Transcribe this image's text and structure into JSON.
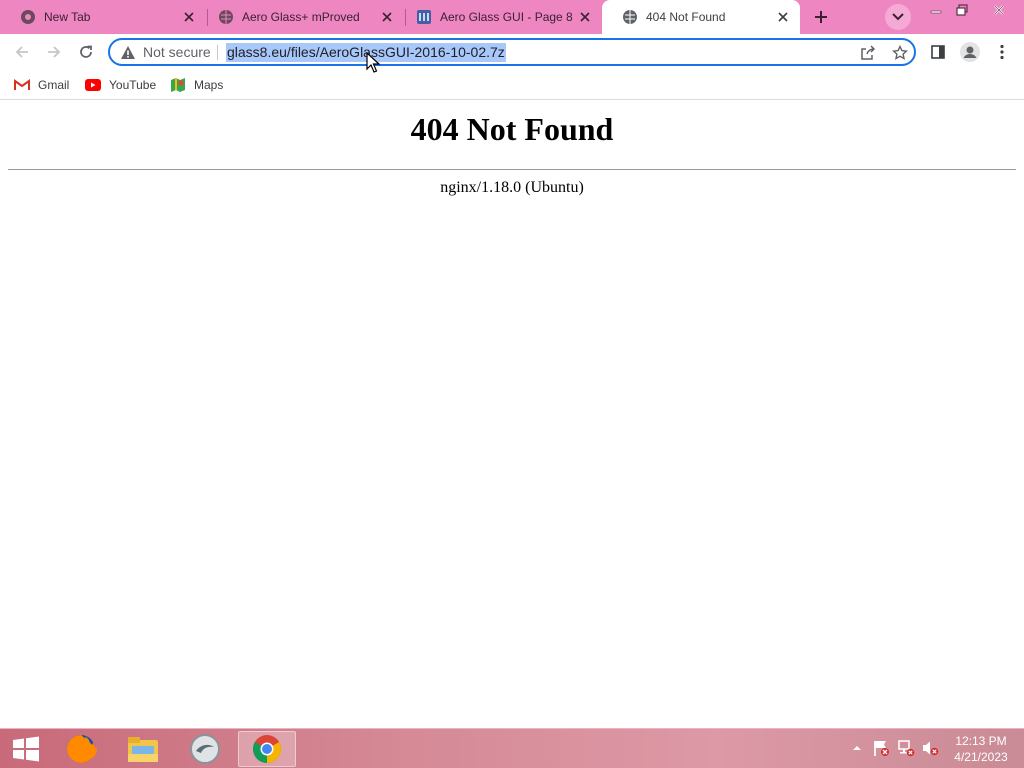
{
  "tabs": [
    {
      "title": "New Tab",
      "favicon": "chrome-icon"
    },
    {
      "title": "Aero Glass+ mProved",
      "favicon": "globe-icon"
    },
    {
      "title": "Aero Glass GUI - Page 8",
      "favicon": "forum-icon"
    },
    {
      "title": "404 Not Found",
      "favicon": "globe-icon",
      "active": true
    }
  ],
  "omnibox": {
    "security_label": "Not secure",
    "url": "glass8.eu/files/AeroGlassGUI-2016-10-02.7z"
  },
  "bookmarks": [
    {
      "label": "Gmail",
      "icon": "gmail-icon"
    },
    {
      "label": "YouTube",
      "icon": "youtube-icon"
    },
    {
      "label": "Maps",
      "icon": "maps-icon"
    }
  ],
  "page": {
    "heading": "404 Not Found",
    "server": "nginx/1.18.0 (Ubuntu)"
  },
  "taskbar": {
    "apps": [
      "firefox-icon",
      "file-explorer-icon",
      "app-icon",
      "chrome-icon"
    ],
    "time": "12:13 PM",
    "date": "4/21/2023"
  },
  "colors": {
    "tabstrip": "#ee86c2",
    "focus_ring": "#1a73e8",
    "url_selection": "#a8c7fa"
  }
}
